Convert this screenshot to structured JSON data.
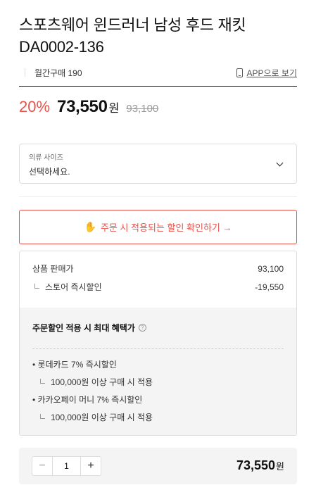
{
  "product": {
    "title": "스포츠웨어 윈드러너 남성 후드 재킷 DA0002-136",
    "monthly_purchases": "월간구매 190",
    "app_link": "APP으로 보기"
  },
  "pricing": {
    "discount_rate": "20%",
    "price": "73,550",
    "currency_unit": "원",
    "original_price": "93,100"
  },
  "option": {
    "label": "의류 사이즈",
    "placeholder": "선택하세요."
  },
  "discount_check_button": {
    "label": "주문 시 적용되는 할인 확인하기 →",
    "icon": "✋"
  },
  "benefits": {
    "sale_price_label": "상품 판매가",
    "sale_price_value": "93,100",
    "store_discount_label": "스토어 즉시할인",
    "store_discount_value": "-19,550",
    "max_benefit_title": "주문할인 적용 시 최대 혜택가",
    "cards": [
      {
        "name": "• 롯데카드 7% 즉시할인",
        "condition": "100,000원 이상 구매 시 적용"
      },
      {
        "name": "• 카카오페이 머니 7% 즉시할인",
        "condition": "100,000원 이상 구매 시 적용"
      }
    ]
  },
  "order": {
    "minus": "−",
    "quantity": "1",
    "plus": "+",
    "total_price": "73,550",
    "total_unit": "원"
  },
  "colors": {
    "accent_red": "#e5534b",
    "panel_gray": "#f4f4f4"
  },
  "icons": [
    "phone-icon",
    "chevron-down-icon",
    "hand-icon",
    "help-icon"
  ]
}
